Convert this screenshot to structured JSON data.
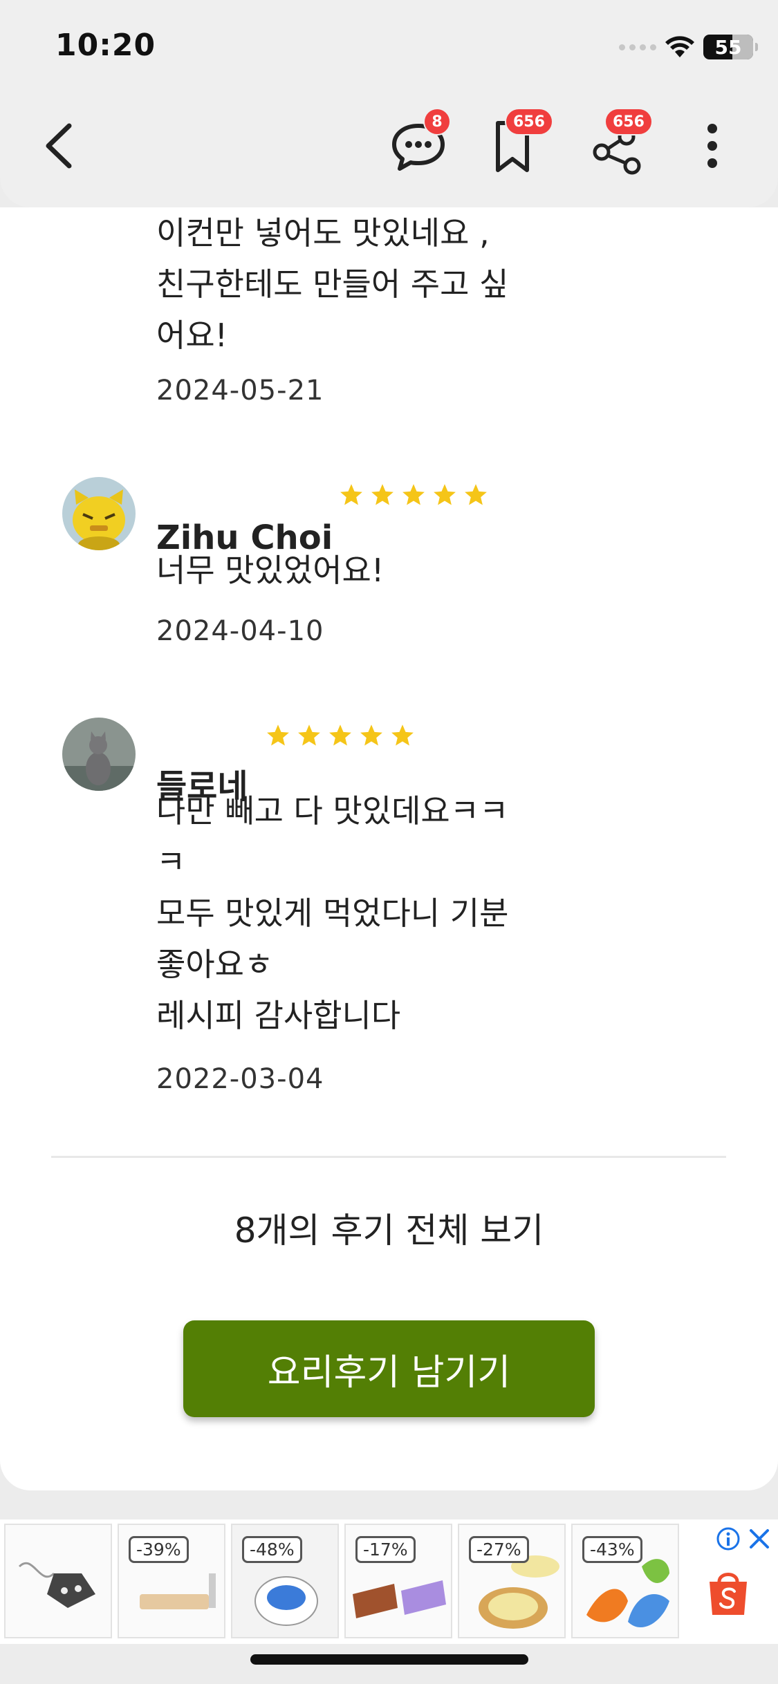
{
  "status_bar": {
    "time": "10:20",
    "battery": "55"
  },
  "nav": {
    "chat_badge": "8",
    "bookmark_badge": "656",
    "share_badge": "656"
  },
  "reviews": [
    {
      "text": "이컨만 넣어도 맛있네요 ,\n친구한테도 만들어 주고 싶\n어요!",
      "date": "2024-05-21"
    },
    {
      "name": "Zihu Choi",
      "text": "너무 맛있었어요!",
      "date": "2024-04-10",
      "rating": 5
    },
    {
      "name": "들로네",
      "text": "나만 빼고 다 맛있데요ㅋㅋ\nㅋ\n모두 맛있게 먹었다니 기분\n좋아요ㅎ\n레시피 감사합니다",
      "date": "2022-03-04",
      "rating": 5
    }
  ],
  "see_all_label": "8개의 후기 전체 보기",
  "write_review_button": "요리후기 남기기",
  "ads": {
    "discounts": [
      "-39%",
      "-48%",
      "-17%",
      "-27%",
      "-43%"
    ]
  },
  "colors": {
    "accent_green": "#537f05",
    "badge_red": "#f03e3e",
    "star_yellow": "#f5c518"
  }
}
